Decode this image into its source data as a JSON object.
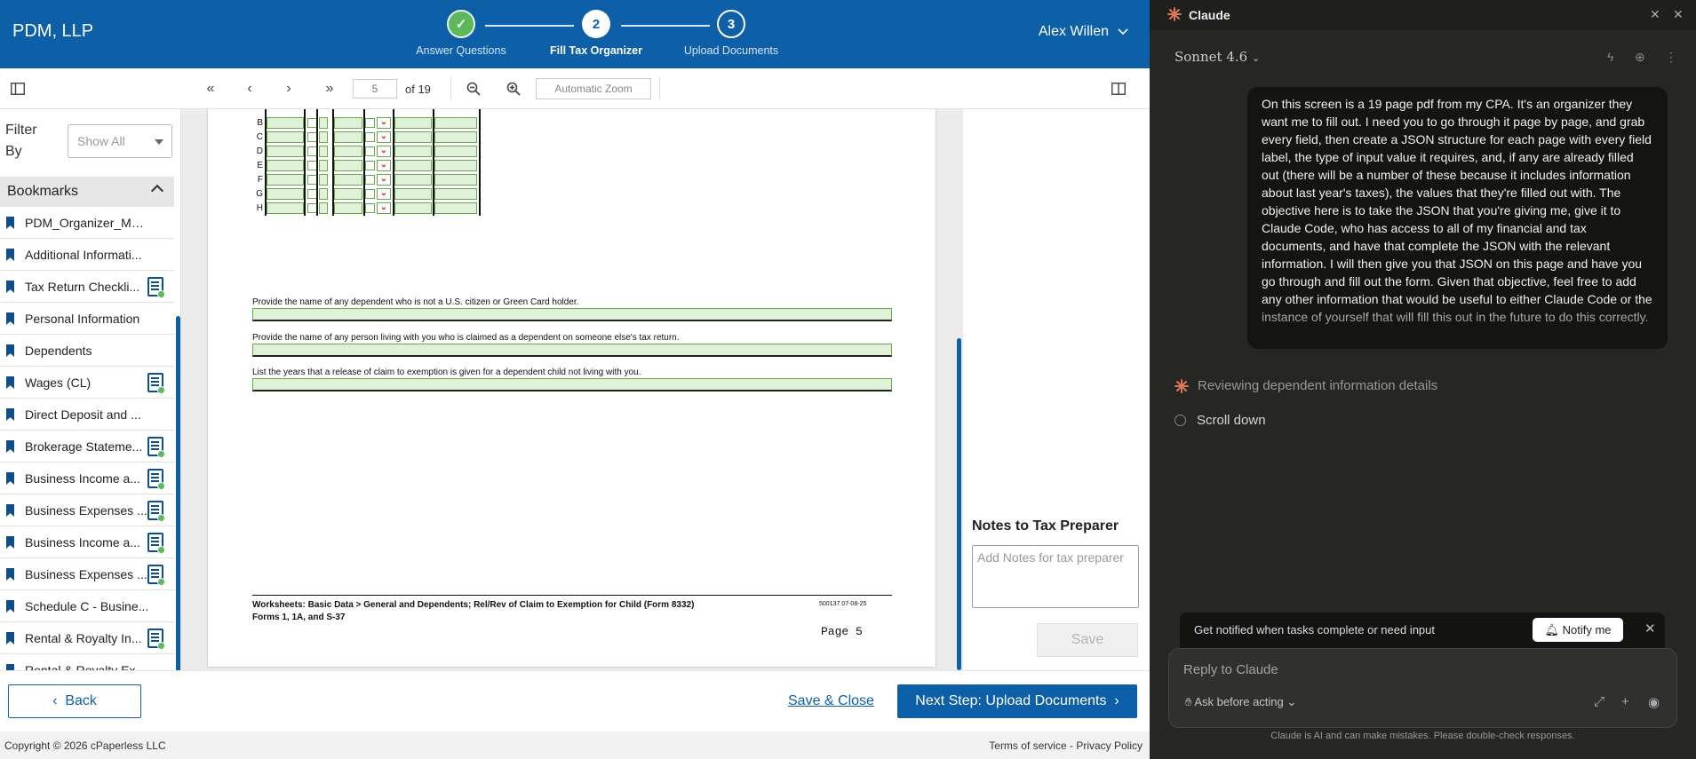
{
  "app": {
    "brand": "PDM, LLP",
    "steps": [
      {
        "number": "",
        "label": "Answer Questions",
        "status": "done"
      },
      {
        "number": "2",
        "label": "Fill Tax Organizer",
        "status": "active"
      },
      {
        "number": "3",
        "label": "Upload Documents",
        "status": "todo"
      }
    ],
    "user_name": "Alex Willen"
  },
  "toolbar": {
    "page_input": "5",
    "page_of": "of 19",
    "zoom": "Automatic Zoom"
  },
  "sidebar": {
    "filter_label_1": "Filter",
    "filter_label_2": "By",
    "filter_value": "Show All",
    "bookmarks_title": "Bookmarks",
    "items": [
      {
        "label": "PDM_Organizer_Mai...",
        "has_doc": false
      },
      {
        "label": "Additional Informati...",
        "has_doc": false
      },
      {
        "label": "Tax Return Checkli...",
        "has_doc": true
      },
      {
        "label": "Personal Information",
        "has_doc": false
      },
      {
        "label": "Dependents",
        "has_doc": false
      },
      {
        "label": "Wages (CL)",
        "has_doc": true
      },
      {
        "label": "Direct Deposit and ...",
        "has_doc": false
      },
      {
        "label": "Brokerage Stateme...",
        "has_doc": true
      },
      {
        "label": "Business Income a...",
        "has_doc": true
      },
      {
        "label": "Business Expenses ...",
        "has_doc": true
      },
      {
        "label": "Business Income a...",
        "has_doc": true
      },
      {
        "label": "Business Expenses ...",
        "has_doc": true
      },
      {
        "label": "Schedule C - Busine...",
        "has_doc": false
      },
      {
        "label": "Rental & Royalty In...",
        "has_doc": true
      },
      {
        "label": "Rental & Royalty Ex...",
        "has_doc": false
      }
    ]
  },
  "document": {
    "row_letters": [
      "B",
      "C",
      "D",
      "E",
      "F",
      "G",
      "H"
    ],
    "prompts": [
      "Provide the name of any dependent who is not a U.S. citizen or Green Card holder.",
      "Provide the name of any person living with you who is claimed as a dependent on someone else's tax return.",
      "List the years that a release of claim to exemption is given for a dependent child not living with you."
    ],
    "footer_line1": "Worksheets: Basic Data > General and Dependents; Rel/Rev of Claim to Exemption for Child (Form 8332)",
    "footer_line2": "Forms 1, 1A, and S-37",
    "footer_code": "500137  07-08-25",
    "footer_page": "Page 5"
  },
  "notes": {
    "title": "Notes to Tax Preparer",
    "placeholder": "Add Notes for tax preparer",
    "save_label": "Save"
  },
  "bottom": {
    "back_label": "Back",
    "save_close_label": "Save & Close",
    "next_label": "Next Step: Upload Documents",
    "copyright": "Copyright © 2026 cPaperless LLC",
    "terms": "Terms of service",
    "sep": "-",
    "privacy": "Privacy Policy"
  },
  "claude": {
    "title": "Claude",
    "model": "Sonnet 4.6",
    "user_message": "On this screen is a 19 page pdf from my CPA. It's an organizer they want me to fill out. I need you to go through it page by page, and grab every field, then create a JSON structure for each page with every field label, the type of input value it requires, and, if any are already filled out (there will be a number of these because it includes information about last year's taxes), the values that they're filled out with. The objective here is to take the JSON that you're giving me, give it to Claude Code, who has access to all of my financial and tax documents, and have that complete the JSON with the relevant information. I will then give you that JSON on this page and have you go through and fill out the form. Given that objective, feel free to add any other information that would be useful to either Claude Code or the instance of yourself that will fill this out in the future to do this correctly.",
    "status": "Reviewing dependent information details",
    "step": "Scroll down",
    "notify_text": "Get notified when tasks complete or need input",
    "notify_button": "Notify me",
    "input_placeholder": "Reply to Claude",
    "ask_mode": "Ask before acting",
    "disclaimer": "Claude is AI and can make mistakes. Please double-check responses."
  },
  "colors": {
    "brand_blue": "#0d5fa7",
    "step_done_green": "#5cb85c",
    "field_green": "#dff2d8",
    "claude_bg": "#262624",
    "claude_accent": "#d97757"
  }
}
